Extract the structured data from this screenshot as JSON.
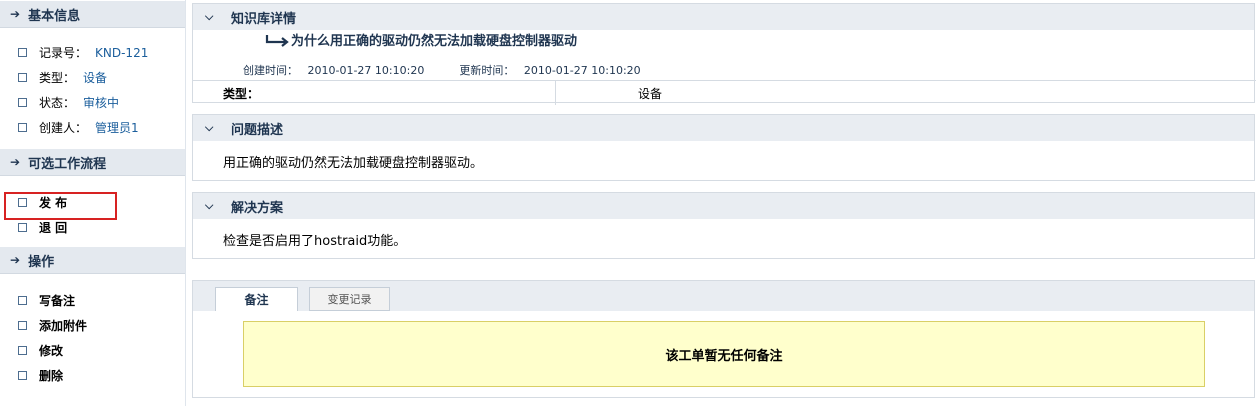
{
  "sidebar": {
    "basic_info": {
      "title": "基本信息",
      "items": [
        {
          "label": "记录号：",
          "value": "KND-121"
        },
        {
          "label": "类型：",
          "value": "设备"
        },
        {
          "label": "状态：",
          "value": "审核中"
        },
        {
          "label": "创建人：",
          "value": "管理员1"
        }
      ]
    },
    "workflow": {
      "title": "可选工作流程",
      "items": [
        {
          "label": "发 布"
        },
        {
          "label": "退 回"
        }
      ]
    },
    "operations": {
      "title": "操作",
      "items": [
        {
          "label": "写备注"
        },
        {
          "label": "添加附件"
        },
        {
          "label": "修改"
        },
        {
          "label": "删除"
        }
      ]
    }
  },
  "kb_detail": {
    "header": "知识库详情",
    "title": "为什么用正确的驱动仍然无法加载硬盘控制器驱动",
    "created_label": "创建时间：",
    "created_value": "2010-01-27 10:10:20",
    "updated_label": "更新时间：",
    "updated_value": "2010-01-27 10:10:20",
    "type_label": "类型：",
    "type_value": "设备"
  },
  "problem": {
    "header": "问题描述",
    "text": "用正确的驱动仍然无法加载硬盘控制器驱动。"
  },
  "solution": {
    "header": "解决方案",
    "text": "检查是否启用了hostraid功能。"
  },
  "notes": {
    "tabs": [
      "备注",
      "变更记录"
    ],
    "empty_text": "该工单暂无任何备注"
  },
  "colors": {
    "header_bg": "#e9edf2",
    "header_text": "#1f3550",
    "link_value": "#1b5e9c",
    "highlight_border": "#d72222",
    "note_bg": "#ffffcc"
  }
}
